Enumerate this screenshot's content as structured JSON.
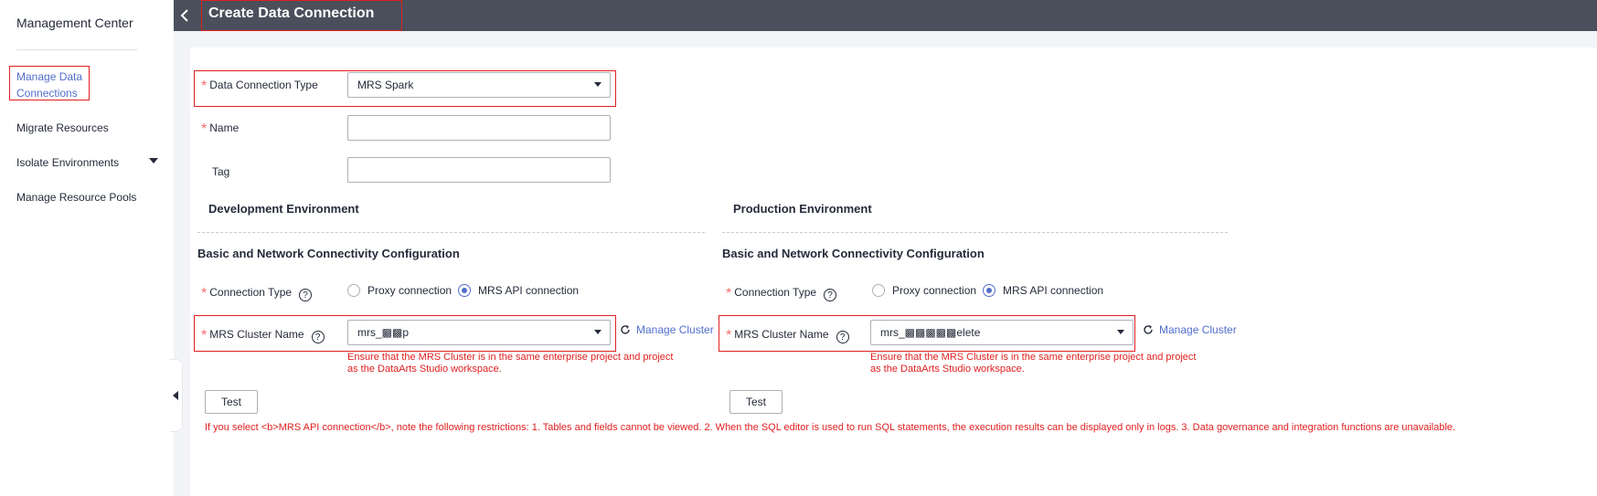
{
  "sidebar": {
    "title": "Management Center",
    "items": [
      {
        "label": "Manage Data Connections",
        "line1": "Manage Data",
        "line2": "Connections"
      },
      {
        "label": "Migrate Resources"
      },
      {
        "label": "Isolate Environments"
      },
      {
        "label": "Manage Resource Pools"
      }
    ]
  },
  "header": {
    "title": "Create Data Connection"
  },
  "form": {
    "type_label": "Data Connection Type",
    "type_value": "MRS Spark",
    "name_label": "Name",
    "name_value": "",
    "tag_label": "Tag",
    "tag_value": ""
  },
  "dev": {
    "env_title": "Development Environment",
    "config_title": "Basic and Network Connectivity Configuration",
    "conn_type_label": "Connection Type",
    "radio_proxy": "Proxy connection",
    "radio_api": "MRS API connection",
    "cluster_label": "MRS Cluster Name",
    "cluster_value": "mrs_▩▩p",
    "manage_cluster": "Manage Cluster",
    "error_line1": "Ensure that the MRS Cluster is in the same enterprise project and project",
    "error_line2": "as the DataArts Studio workspace.",
    "test_button": "Test"
  },
  "prod": {
    "env_title": "Production Environment",
    "config_title": "Basic and Network Connectivity Configuration",
    "conn_type_label": "Connection Type",
    "radio_proxy": "Proxy connection",
    "radio_api": "MRS API connection",
    "cluster_label": "MRS Cluster Name",
    "cluster_value": "mrs_▩▩▩▩▩elete",
    "manage_cluster": "Manage Cluster",
    "error_line1": "Ensure that the MRS Cluster is in the same enterprise project and project",
    "error_line2": "as the DataArts Studio workspace.",
    "test_button": "Test"
  },
  "note": "If you select <b>MRS API connection</b>, note the following restrictions: 1. Tables and fields cannot be viewed. 2. When the SQL editor is used to run SQL statements, the execution results can be displayed only in logs. 3. Data governance and integration functions are unavailable.",
  "colors": {
    "accent": "#526ecc",
    "error": "#e02020",
    "header_bg": "#4a4f5b"
  }
}
